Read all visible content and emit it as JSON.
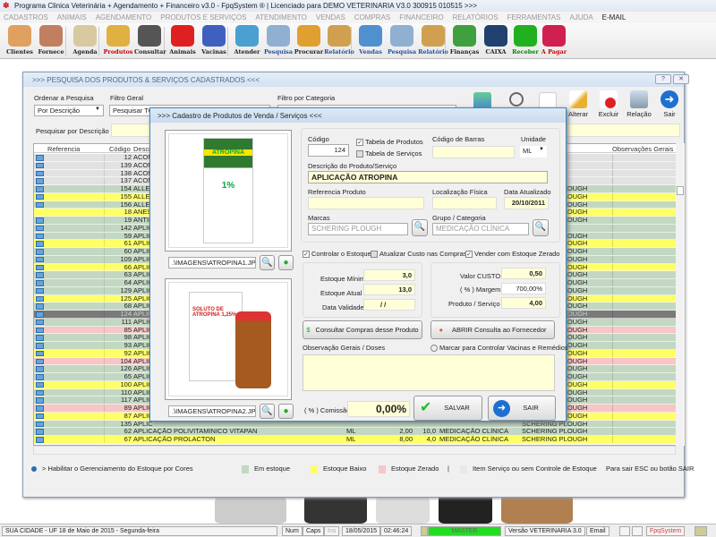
{
  "app": {
    "title": "Programa Clinica Veterinária + Agendamento + Financeiro v3.0 - FpqSystem ® | Licenciado para  DEMO VETERINARIA V3.0 300915 010515 >>>"
  },
  "menu": [
    "CADASTROS",
    "ANIMAIS",
    "AGENDAMENTO",
    "PRODUTOS E SERVIÇOS",
    "ATENDIMENTO",
    "VENDAS",
    "COMPRAS",
    "FINANCEIRO",
    "RELATÓRIOS",
    "FERRAMENTAS",
    "AJUDA"
  ],
  "menu_email": "E-MAIL",
  "toolbar": [
    {
      "label": "Clientes",
      "icon": "clients-icon",
      "color": "#e0a060"
    },
    {
      "label": "Fornece",
      "icon": "supplier-icon",
      "color": "#c08060"
    },
    {
      "label": "Agenda",
      "icon": "agenda-icon",
      "color": "#d9c9a0"
    },
    {
      "label": "Produtos",
      "icon": "products-icon",
      "color": "#e0b040",
      "labelColor": "#c00"
    },
    {
      "label": "Consultar",
      "icon": "barcode-icon",
      "color": "#555"
    },
    {
      "label": "Animais",
      "icon": "paw-icon",
      "color": "#e02020"
    },
    {
      "label": "Vacinas",
      "icon": "syringe-icon",
      "color": "#4060c0"
    },
    {
      "label": "Atender",
      "icon": "paw-plus-icon",
      "color": "#4aa0d0"
    },
    {
      "label": "Pesquisa",
      "icon": "search-doc-icon",
      "color": "#8fb0d0",
      "labelColor": "#2050a0"
    },
    {
      "label": "Procurar",
      "icon": "folder-icon",
      "color": "#e0a030"
    },
    {
      "label": "Relatório",
      "icon": "printer-icon",
      "color": "#d0a050",
      "labelColor": "#2050a0"
    },
    {
      "label": "Vendas",
      "icon": "monitor-icon",
      "color": "#5090d0",
      "labelColor": "#2050a0"
    },
    {
      "label": "Pesquisa",
      "icon": "search-doc-icon",
      "color": "#8fb0d0",
      "labelColor": "#2050a0"
    },
    {
      "label": "Relatório",
      "icon": "printer-icon",
      "color": "#d0a050",
      "labelColor": "#2050a0"
    },
    {
      "label": "Finanças",
      "icon": "finance-icon",
      "color": "#40a040"
    },
    {
      "label": "CAIXA",
      "icon": "cashbook-icon",
      "color": "#204070"
    },
    {
      "label": "Receber",
      "icon": "receive-dollar-icon",
      "color": "#20b020",
      "labelColor": "#080"
    },
    {
      "label": "A Pagar",
      "icon": "pay-dollar-icon",
      "color": "#d02050",
      "labelColor": "#c00"
    }
  ],
  "main": {
    "title": ">>>  PESQUISA DOS PRODUTOS & SERVIÇOS CADASTRADOS  <<<",
    "help": "?",
    "close": "✕",
    "order_label": "Ordenar a Pesquisa",
    "order_value": "Por Descrição",
    "filter_label": "Filtro Geral",
    "filter_value": "Pesquisar TODOS",
    "category_label": "Filtro por Categoria",
    "search_label": "Pesquisar por Descrição",
    "search_value": "",
    "buttons": {
      "alterar": "Alterar",
      "excluir": "Excluir",
      "relacao": "Relação",
      "sair": "Sair"
    },
    "columns": [
      "Referencia",
      "Código",
      "Descrição",
      "Observações Gerais"
    ],
    "rows": [
      {
        "code": "12",
        "desc": "ACOM",
        "status": "gray"
      },
      {
        "code": "139",
        "desc": "ACOM",
        "status": "gray"
      },
      {
        "code": "138",
        "desc": "ACOM",
        "status": "gray"
      },
      {
        "code": "137",
        "desc": "ACOM",
        "status": "gray"
      },
      {
        "code": "154",
        "desc": "ALLER",
        "status": "green",
        "brand": "SCHERING PLOUGH"
      },
      {
        "code": "155",
        "desc": "ALLER",
        "status": "yellow",
        "brand": "SCHERING PLOUGH"
      },
      {
        "code": "156",
        "desc": "ALLER",
        "status": "green",
        "brand": "SCHERING PLOUGH"
      },
      {
        "code": "18",
        "desc": "ANES",
        "status": "yellow",
        "noicon": true,
        "brand": "SCHERING PLOUGH"
      },
      {
        "code": "19",
        "desc": "ANTID",
        "status": "green",
        "brand": "SCHERING PLOUGH"
      },
      {
        "code": "142",
        "desc": "APLIC",
        "status": "green"
      },
      {
        "code": "59",
        "desc": "APLIC",
        "status": "green",
        "brand": "SCHERING PLOUGH"
      },
      {
        "code": "61",
        "desc": "APLIC",
        "status": "yellow",
        "brand": "SCHERING PLOUGH"
      },
      {
        "code": "60",
        "desc": "APLIC",
        "status": "green",
        "brand": "SCHERING PLOUGH"
      },
      {
        "code": "109",
        "desc": "APLIC",
        "status": "green",
        "brand": "SCHERING PLOUGH"
      },
      {
        "code": "66",
        "desc": "APLIC",
        "status": "yellow",
        "brand": "SCHERING PLOUGH"
      },
      {
        "code": "63",
        "desc": "APLIC",
        "status": "green",
        "brand": "SCHERING PLOUGH"
      },
      {
        "code": "64",
        "desc": "APLIC",
        "status": "green",
        "brand": "SCHERING PLOUGH"
      },
      {
        "code": "129",
        "desc": "APLIC",
        "status": "green",
        "brand": "SCHERING PLOUGH"
      },
      {
        "code": "125",
        "desc": "APLIC",
        "status": "yellow",
        "brand": "SCHERING PLOUGH"
      },
      {
        "code": "68",
        "desc": "APLIC",
        "status": "green",
        "brand": "SCHERING PLOUGH"
      },
      {
        "code": "124",
        "desc": "APLIC",
        "status": "selected",
        "brand": "SCHERING PLOUGH"
      },
      {
        "code": "111",
        "desc": "APLIC",
        "status": "green",
        "brand": "SCHERING PLOUGH"
      },
      {
        "code": "85",
        "desc": "APLIC",
        "status": "pink",
        "brand": "SCHERING PLOUGH"
      },
      {
        "code": "98",
        "desc": "APLIC",
        "status": "green",
        "brand": "SCHERING PLOUGH"
      },
      {
        "code": "93",
        "desc": "APLIC",
        "status": "green",
        "brand": "SCHERING PLOUGH"
      },
      {
        "code": "92",
        "desc": "APLIC",
        "status": "yellow",
        "brand": "SCHERING PLOUGH"
      },
      {
        "code": "104",
        "desc": "APLIC",
        "status": "pink",
        "brand": "SCHERING PLOUGH"
      },
      {
        "code": "126",
        "desc": "APLIC",
        "status": "green",
        "brand": "SCHERING PLOUGH"
      },
      {
        "code": "65",
        "desc": "APLIC",
        "status": "green",
        "brand": "SCHERING PLOUGH"
      },
      {
        "code": "100",
        "desc": "APLIC",
        "status": "yellow",
        "brand": "SCHERING PLOUGH"
      },
      {
        "code": "110",
        "desc": "APLIC",
        "status": "green",
        "brand": "SCHERING PLOUGH"
      },
      {
        "code": "117",
        "desc": "APLIC",
        "status": "green",
        "brand": "SCHERING PLOUGH"
      },
      {
        "code": "89",
        "desc": "APLIC",
        "status": "pink",
        "brand": "SCHERING PLOUGH"
      },
      {
        "code": "87",
        "desc": "APLIC",
        "status": "yellow",
        "brand": "SCHERING PLOUGH"
      },
      {
        "code": "135",
        "desc": "APLIC",
        "status": "green",
        "brand": "SCHERING PLOUGH"
      },
      {
        "code": "62",
        "desc": "APLICAÇÃO POLIVITAMINICO VITAPAN",
        "status": "green",
        "unit": "ML",
        "price": "2,00",
        "stock": "10,0",
        "category": "MEDICAÇÃO CLÍNICA",
        "brand": "SCHERING PLOUGH"
      },
      {
        "code": "67",
        "desc": "APLICAÇÃO PROLACTON",
        "status": "yellow",
        "unit": "ML",
        "price": "8,00",
        "stock": "4,0",
        "category": "MEDICAÇÃO CLÍNICA",
        "brand": "SCHERING PLOUGH"
      }
    ],
    "legend": {
      "enable": "> Habilitar o Gerenciamento do Estoque por Cores",
      "in_stock": "Em estoque",
      "low": "Estoque Baixo",
      "zero": "Estoque Zerado",
      "sep": "|",
      "service": "Item Serviço ou sem Controle de Estoque",
      "exit_hint": "Para sair ESC ou botão SAIR"
    }
  },
  "colors": {
    "green": "#c3d8c3",
    "yellow": "#ffff66",
    "pink": "#f7c6c6",
    "gray": "#e2e2e2",
    "selected": "#7a7a7a"
  },
  "dialog": {
    "title": ">>>  Cadastro de Produtos de Venda / Serviços  <<<",
    "image1_path": ".\\IMAGENS\\ATROPINA1.JPG",
    "image1_text": "ATROPINA",
    "image1_sub": "1%",
    "image2_path": ".\\IMAGENS\\ATROPINA2.JPG",
    "image2_text": "SOLUTO DE ATROPINA 1,25%",
    "code_label": "Código",
    "code": "124",
    "chk_products": "Tabela de Produtos",
    "chk_services": "Tabela de Serviços",
    "barcode_label": "Código de Barras",
    "barcode": "",
    "unit_label": "Unidade",
    "unit": "ML",
    "desc_label": "Descrição do Produto/Serviço",
    "desc": "APLICAÇÃO ATROPINA",
    "ref_label": "Referencia Produto",
    "ref": "",
    "loc_label": "Localização Física",
    "loc": "",
    "date_label": "Data Atualizado",
    "date": "20/10/2011",
    "brand_label": "Marcas",
    "brand": "SCHERING PLOUGH",
    "group_label": "Grupo / Categoria",
    "group": "MEDICAÇÃO CLÍNICA",
    "chk_stock": "Controlar o Estoque",
    "chk_cost": "Atualizar Custo nas Compras",
    "chk_zero": "Vender com Estoque Zerado",
    "min_label": "Estoque Mínimo",
    "min": "3,0",
    "cur_label": "Estoque Atual",
    "cur": "13,0",
    "val_label": "Data Validade",
    "val": " /  /",
    "cost_label": "Valor CUSTO",
    "cost": "0,50",
    "margin_label": "( % ) Margem",
    "margin": "700,00%",
    "price_label": "Produto / Serviço",
    "price": "4,00",
    "btn_purchases": "Consultar Compras desse Produto",
    "btn_supplier": "ABRIR Consulta ao Fornecedor",
    "obs_label": "Observação Gerais / Doses",
    "radio_vaccine": "Marcar para Controlar Vacinas e Remédios",
    "obs": "",
    "commission_label": "( % ) Comissão",
    "commission": "0,00%",
    "save": "SALVAR",
    "exit": "SAIR"
  },
  "status": {
    "city": "SUA CIDADE - UF 18 de Maio de 2015 - Segunda-feira",
    "num": "Num",
    "caps": "Caps",
    "ins": "Ins",
    "date": "18/05/2015",
    "time": "02:46:24",
    "user": "MASTER",
    "version": "Versão VETERINARIA 3.0",
    "email": "Email",
    "brand": "FpqSystem"
  }
}
